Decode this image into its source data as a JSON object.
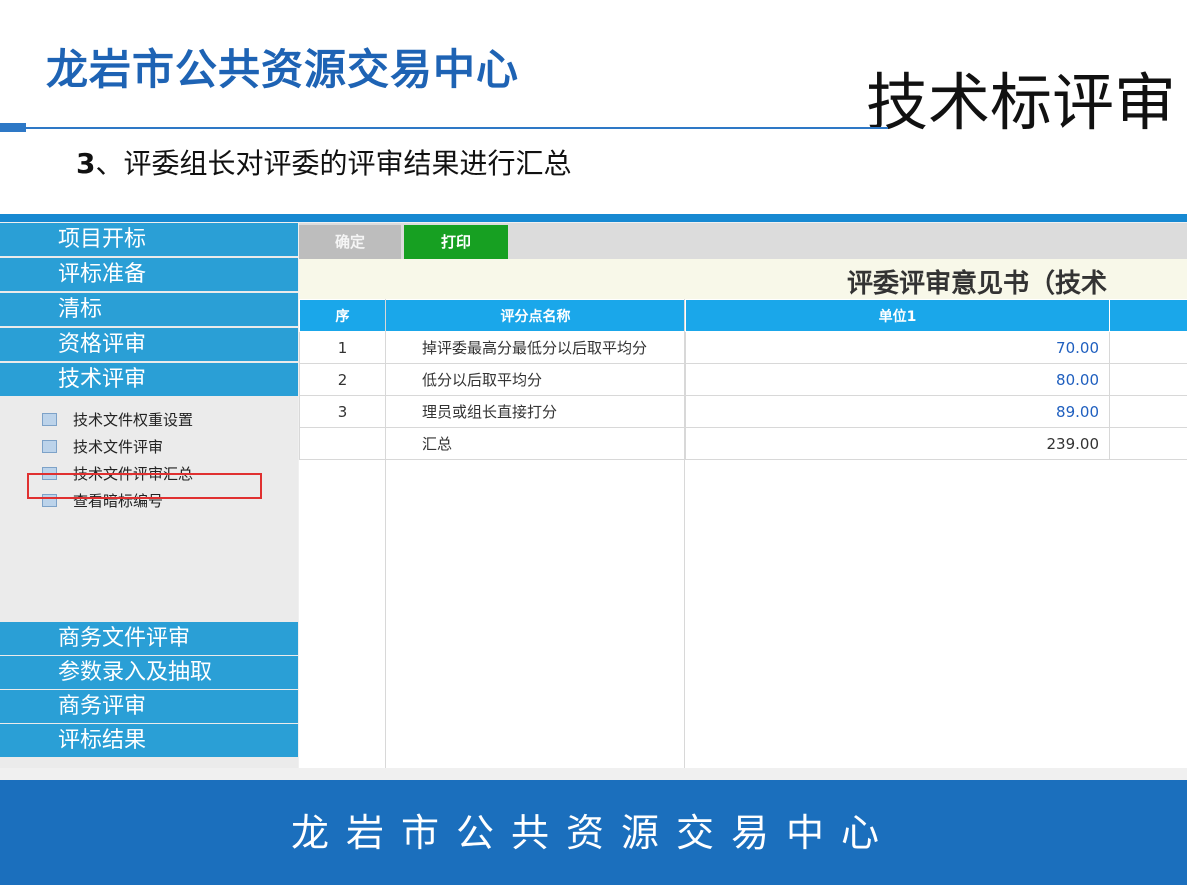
{
  "slide": {
    "org_title": "龙岩市公共资源交易中心",
    "title": "技术标评审",
    "step_number": "3",
    "step_text": "、评委组长对评委的评审结果进行汇总",
    "footer": "龙岩市公共资源交易中心",
    "accent_color": "#1e63b4"
  },
  "sidebar": {
    "top_items": [
      "项目开标",
      "评标准备",
      "清标",
      "资格评审",
      "技术评审"
    ],
    "sub_items": [
      "技术文件权重设置",
      "技术文件评审",
      "技术文件评审汇总",
      "查看暗标编号"
    ],
    "selected_sub_item": "技术文件评审汇总",
    "bottom_items": [
      "商务文件评审",
      "参数录入及抽取",
      "商务评审",
      "评标结果"
    ]
  },
  "toolbar": {
    "confirm_label": "确定",
    "print_label": "打印"
  },
  "form": {
    "title": "评委评审意见书（技术",
    "columns": [
      "序",
      "评分点名称",
      "单位1"
    ],
    "rows": [
      {
        "index": "1",
        "name": "掉评委最高分最低分以后取平均分",
        "value": "70.00"
      },
      {
        "index": "2",
        "name": "低分以后取平均分",
        "value": "80.00"
      },
      {
        "index": "3",
        "name": "理员或组长直接打分",
        "value": "89.00"
      }
    ],
    "total": {
      "label": "汇总",
      "value": "239.00"
    }
  }
}
